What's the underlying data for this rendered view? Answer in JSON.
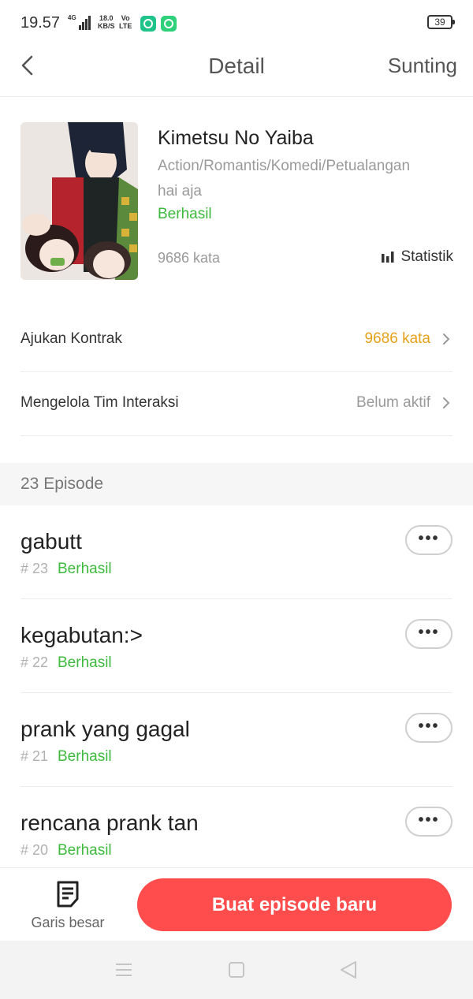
{
  "status_bar": {
    "time": "19.57",
    "network": "4G",
    "speed_top": "18.0",
    "speed_bottom": "KB/S",
    "volte_top": "Vo",
    "volte_bottom": "LTE",
    "battery": "39"
  },
  "header": {
    "title": "Detail",
    "edit_label": "Sunting"
  },
  "book": {
    "title": "Kimetsu No Yaiba",
    "genre": "Action/Romantis/Komedi/Petualangan",
    "description": "hai aja",
    "status": "Berhasil",
    "word_count": "9686 kata",
    "stats_label": "Statistik"
  },
  "options": [
    {
      "label": "Ajukan Kontrak",
      "value": "9686 kata",
      "value_color": "#e6a11a"
    },
    {
      "label": "Mengelola Tim Interaksi",
      "value": "Belum aktif",
      "value_color": "#9a9a9a"
    }
  ],
  "episodes_header": "23 Episode",
  "episodes": [
    {
      "title": "gabutt",
      "number": "# 23",
      "status": "Berhasil",
      "more": "•••"
    },
    {
      "title": "kegabutan:>",
      "number": "# 22",
      "status": "Berhasil",
      "more": "•••"
    },
    {
      "title": "prank yang gagal",
      "number": "# 21",
      "status": "Berhasil",
      "more": "•••"
    },
    {
      "title": "rencana prank tan",
      "number": "# 20",
      "status": "Berhasil",
      "more": "•••"
    }
  ],
  "bottom_bar": {
    "outline_label": "Garis besar",
    "new_episode_label": "Buat episode baru"
  },
  "colors": {
    "accent": "#ff4d4d",
    "success": "#3dba3d",
    "highlight": "#e6a11a"
  },
  "icons": [
    "back-arrow-icon",
    "bar-chart-icon",
    "chevron-right-icon",
    "outline-doc-icon",
    "menu-icon",
    "home-square-icon",
    "back-triangle-icon"
  ]
}
